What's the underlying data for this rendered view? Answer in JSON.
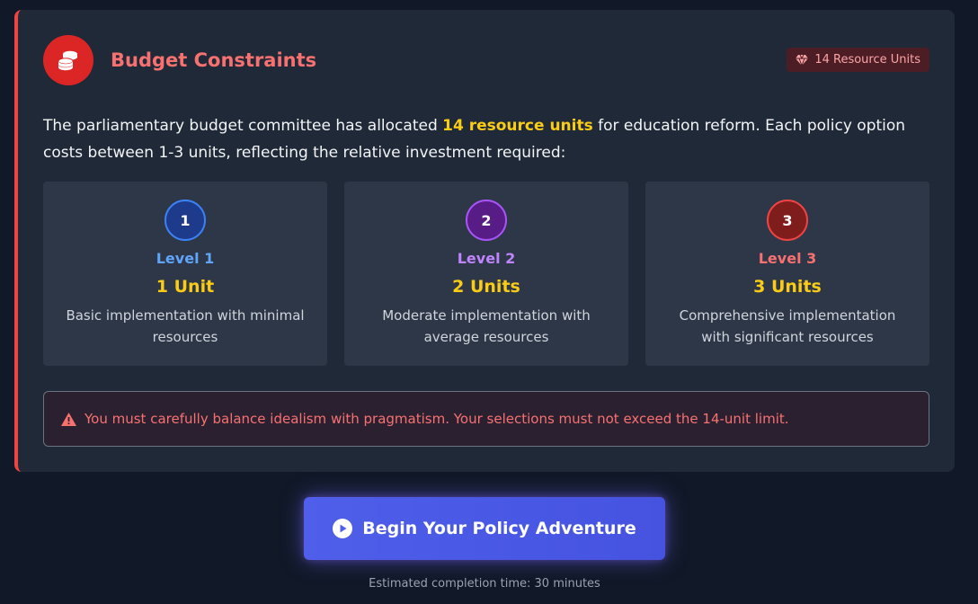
{
  "budget_card": {
    "title": "Budget Constraints",
    "badge": "14 Resource Units",
    "intro_before": "The parliamentary budget committee has allocated ",
    "intro_highlight": "14 resource units",
    "intro_after": " for education reform. Each policy option costs between 1-3 units, reflecting the relative investment required:",
    "levels": [
      {
        "number": "1",
        "name": "Level 1",
        "cost": "1 Unit",
        "description": "Basic implementation with minimal resources"
      },
      {
        "number": "2",
        "name": "Level 2",
        "cost": "2 Units",
        "description": "Moderate implementation with average resources"
      },
      {
        "number": "3",
        "name": "Level 3",
        "cost": "3 Units",
        "description": "Comprehensive implementation with significant resources"
      }
    ],
    "warning": "You must carefully balance idealism with pragmatism. Your selections must not exceed the 14-unit limit."
  },
  "start_button": {
    "label": "Begin Your Policy Adventure",
    "icon": "play-circle-icon"
  },
  "footnote": "Estimated completion time: 30 minutes",
  "icons": {
    "header": "coins-icon",
    "badge": "gem-icon",
    "warning": "warning-triangle-icon"
  },
  "colors": {
    "accent_red": "#ef4444",
    "highlight_yellow": "#facc15",
    "level1": "#60a5fa",
    "level2": "#c084fc",
    "level3": "#f87171",
    "button": "#4f5fea"
  }
}
